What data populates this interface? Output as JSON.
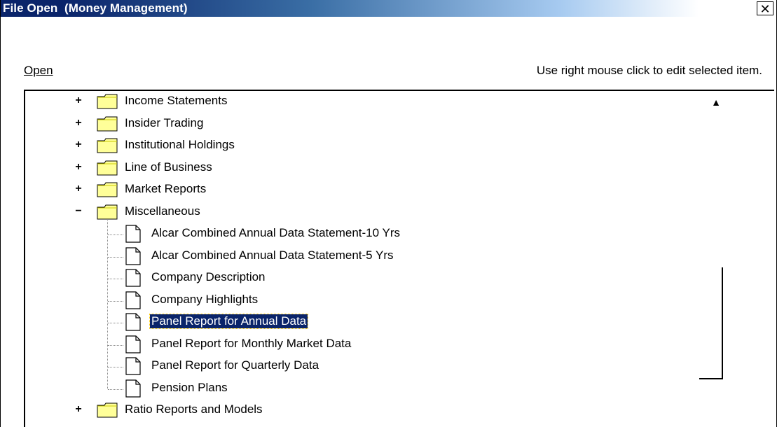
{
  "window": {
    "title": "File Open  (Money Management)",
    "close_glyph": "✕"
  },
  "open_label": "Open",
  "hint": "Use right mouse click to edit selected item.",
  "tree": {
    "folders_top": [
      {
        "label": "Income Statements",
        "expander": "+"
      },
      {
        "label": "Insider Trading",
        "expander": "+"
      },
      {
        "label": "Institutional Holdings",
        "expander": "+"
      },
      {
        "label": "Line of Business",
        "expander": "+"
      },
      {
        "label": "Market Reports",
        "expander": "+"
      },
      {
        "label": "Miscellaneous",
        "expander": "−"
      }
    ],
    "children": [
      {
        "label": "Alcar Combined Annual Data Statement-10 Yrs",
        "selected": false
      },
      {
        "label": "Alcar Combined Annual Data Statement-5 Yrs",
        "selected": false
      },
      {
        "label": "Company Description",
        "selected": false
      },
      {
        "label": "Company Highlights",
        "selected": false
      },
      {
        "label": "Panel Report for Annual Data",
        "selected": true
      },
      {
        "label": "Panel Report for Monthly Market Data",
        "selected": false
      },
      {
        "label": "Panel Report for Quarterly Data",
        "selected": false
      },
      {
        "label": "Pension Plans",
        "selected": false
      }
    ],
    "folders_bottom": [
      {
        "label": "Ratio Reports and Models",
        "expander": "+"
      }
    ],
    "scroll_up_glyph": "▲"
  },
  "colors": {
    "selection_bg": "#0a246a",
    "folder_fill": "#ffff99",
    "titlebar_start": "#0a246a"
  }
}
